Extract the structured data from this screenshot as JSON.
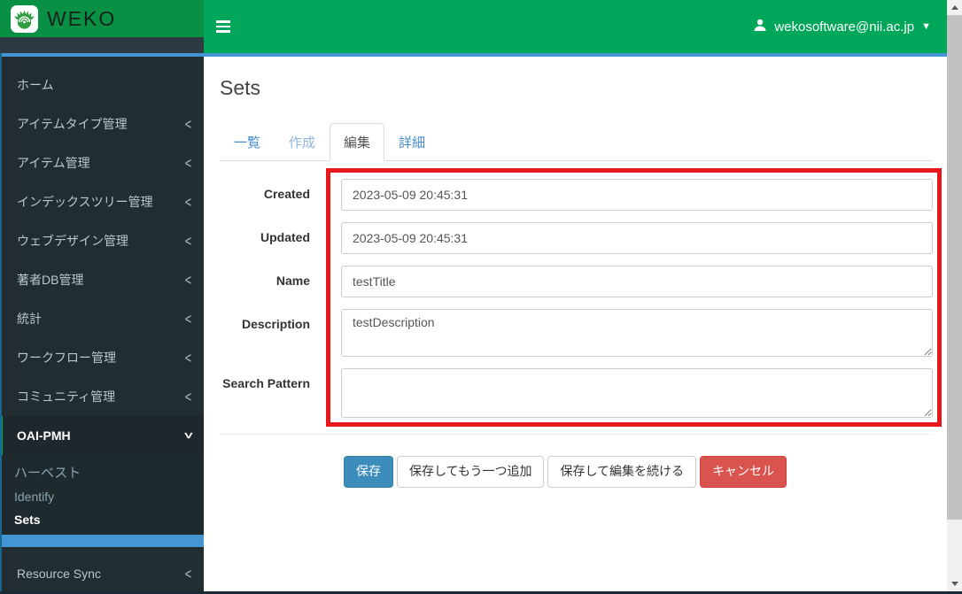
{
  "navbar": {
    "brand": "WEKO",
    "user_email": "wekosoftware@nii.ac.jp"
  },
  "sidebar": {
    "items": [
      {
        "label": "ホーム",
        "chevron": ""
      },
      {
        "label": "アイテムタイプ管理",
        "chevron": "<"
      },
      {
        "label": "アイテム管理",
        "chevron": "<"
      },
      {
        "label": "インデックスツリー管理",
        "chevron": "<"
      },
      {
        "label": "ウェブデザイン管理",
        "chevron": "<"
      },
      {
        "label": "著者DB管理",
        "chevron": "<"
      },
      {
        "label": "統計",
        "chevron": "<"
      },
      {
        "label": "ワークフロー管理",
        "chevron": "<"
      },
      {
        "label": "コミュニティ管理",
        "chevron": "<"
      },
      {
        "label": "OAI-PMH",
        "chevron": "<"
      }
    ],
    "submenu": [
      {
        "label": "ハーベスト"
      },
      {
        "label": "Identify"
      },
      {
        "label": "Sets"
      }
    ],
    "resource_sync": {
      "label": "Resource Sync",
      "chevron": "<"
    }
  },
  "main": {
    "title": "Sets",
    "tabs": [
      {
        "label": "一覧"
      },
      {
        "label": "作成"
      },
      {
        "label": "編集"
      },
      {
        "label": "詳細"
      }
    ],
    "form": {
      "fields": [
        {
          "label": "Created",
          "value": "2023-05-09 20:45:31"
        },
        {
          "label": "Updated",
          "value": "2023-05-09 20:45:31"
        },
        {
          "label": "Name",
          "value": "testTitle"
        },
        {
          "label": "Description",
          "value": "testDescription"
        },
        {
          "label": "Search Pattern",
          "value": ""
        }
      ]
    },
    "buttons": [
      {
        "label": "保存",
        "style": "primary"
      },
      {
        "label": "保存してもう一つ追加",
        "style": "default"
      },
      {
        "label": "保存して編集を続ける",
        "style": "default"
      },
      {
        "label": "キャンセル",
        "style": "danger"
      }
    ]
  },
  "colors": {
    "navbar_green": "#00a65a",
    "logo_green": "#0a9044",
    "sidebar_dark": "#222d32",
    "submenu_dark": "#1f2a2f",
    "highlight_blue": "#4496d3",
    "red_highlight": "#e8191c",
    "primary_button": "#3c8dbc",
    "danger_button": "#d9534f",
    "tab_link_blue": "#428bca"
  }
}
